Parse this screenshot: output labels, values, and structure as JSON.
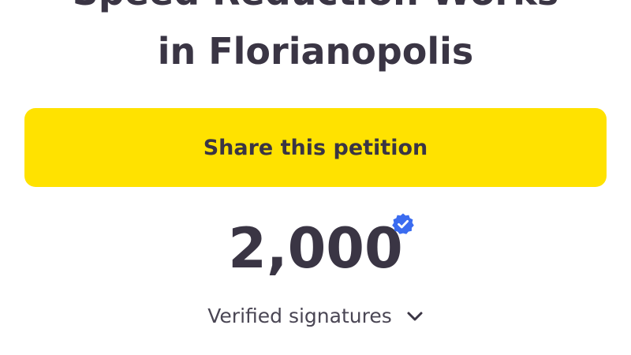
{
  "petition": {
    "title_line_1": "Speed Reduction Works",
    "title_line_2": "in Florianopolis"
  },
  "share_button": {
    "label": "Share this petition"
  },
  "signatures": {
    "count": "2,000",
    "label": "Verified signatures"
  },
  "icons": {
    "verified": "verified-badge-icon",
    "expand": "chevron-down-icon"
  },
  "colors": {
    "accent_yellow": "#ffe200",
    "text_dark": "#3a3544",
    "verified_blue": "#3b6cf0"
  }
}
